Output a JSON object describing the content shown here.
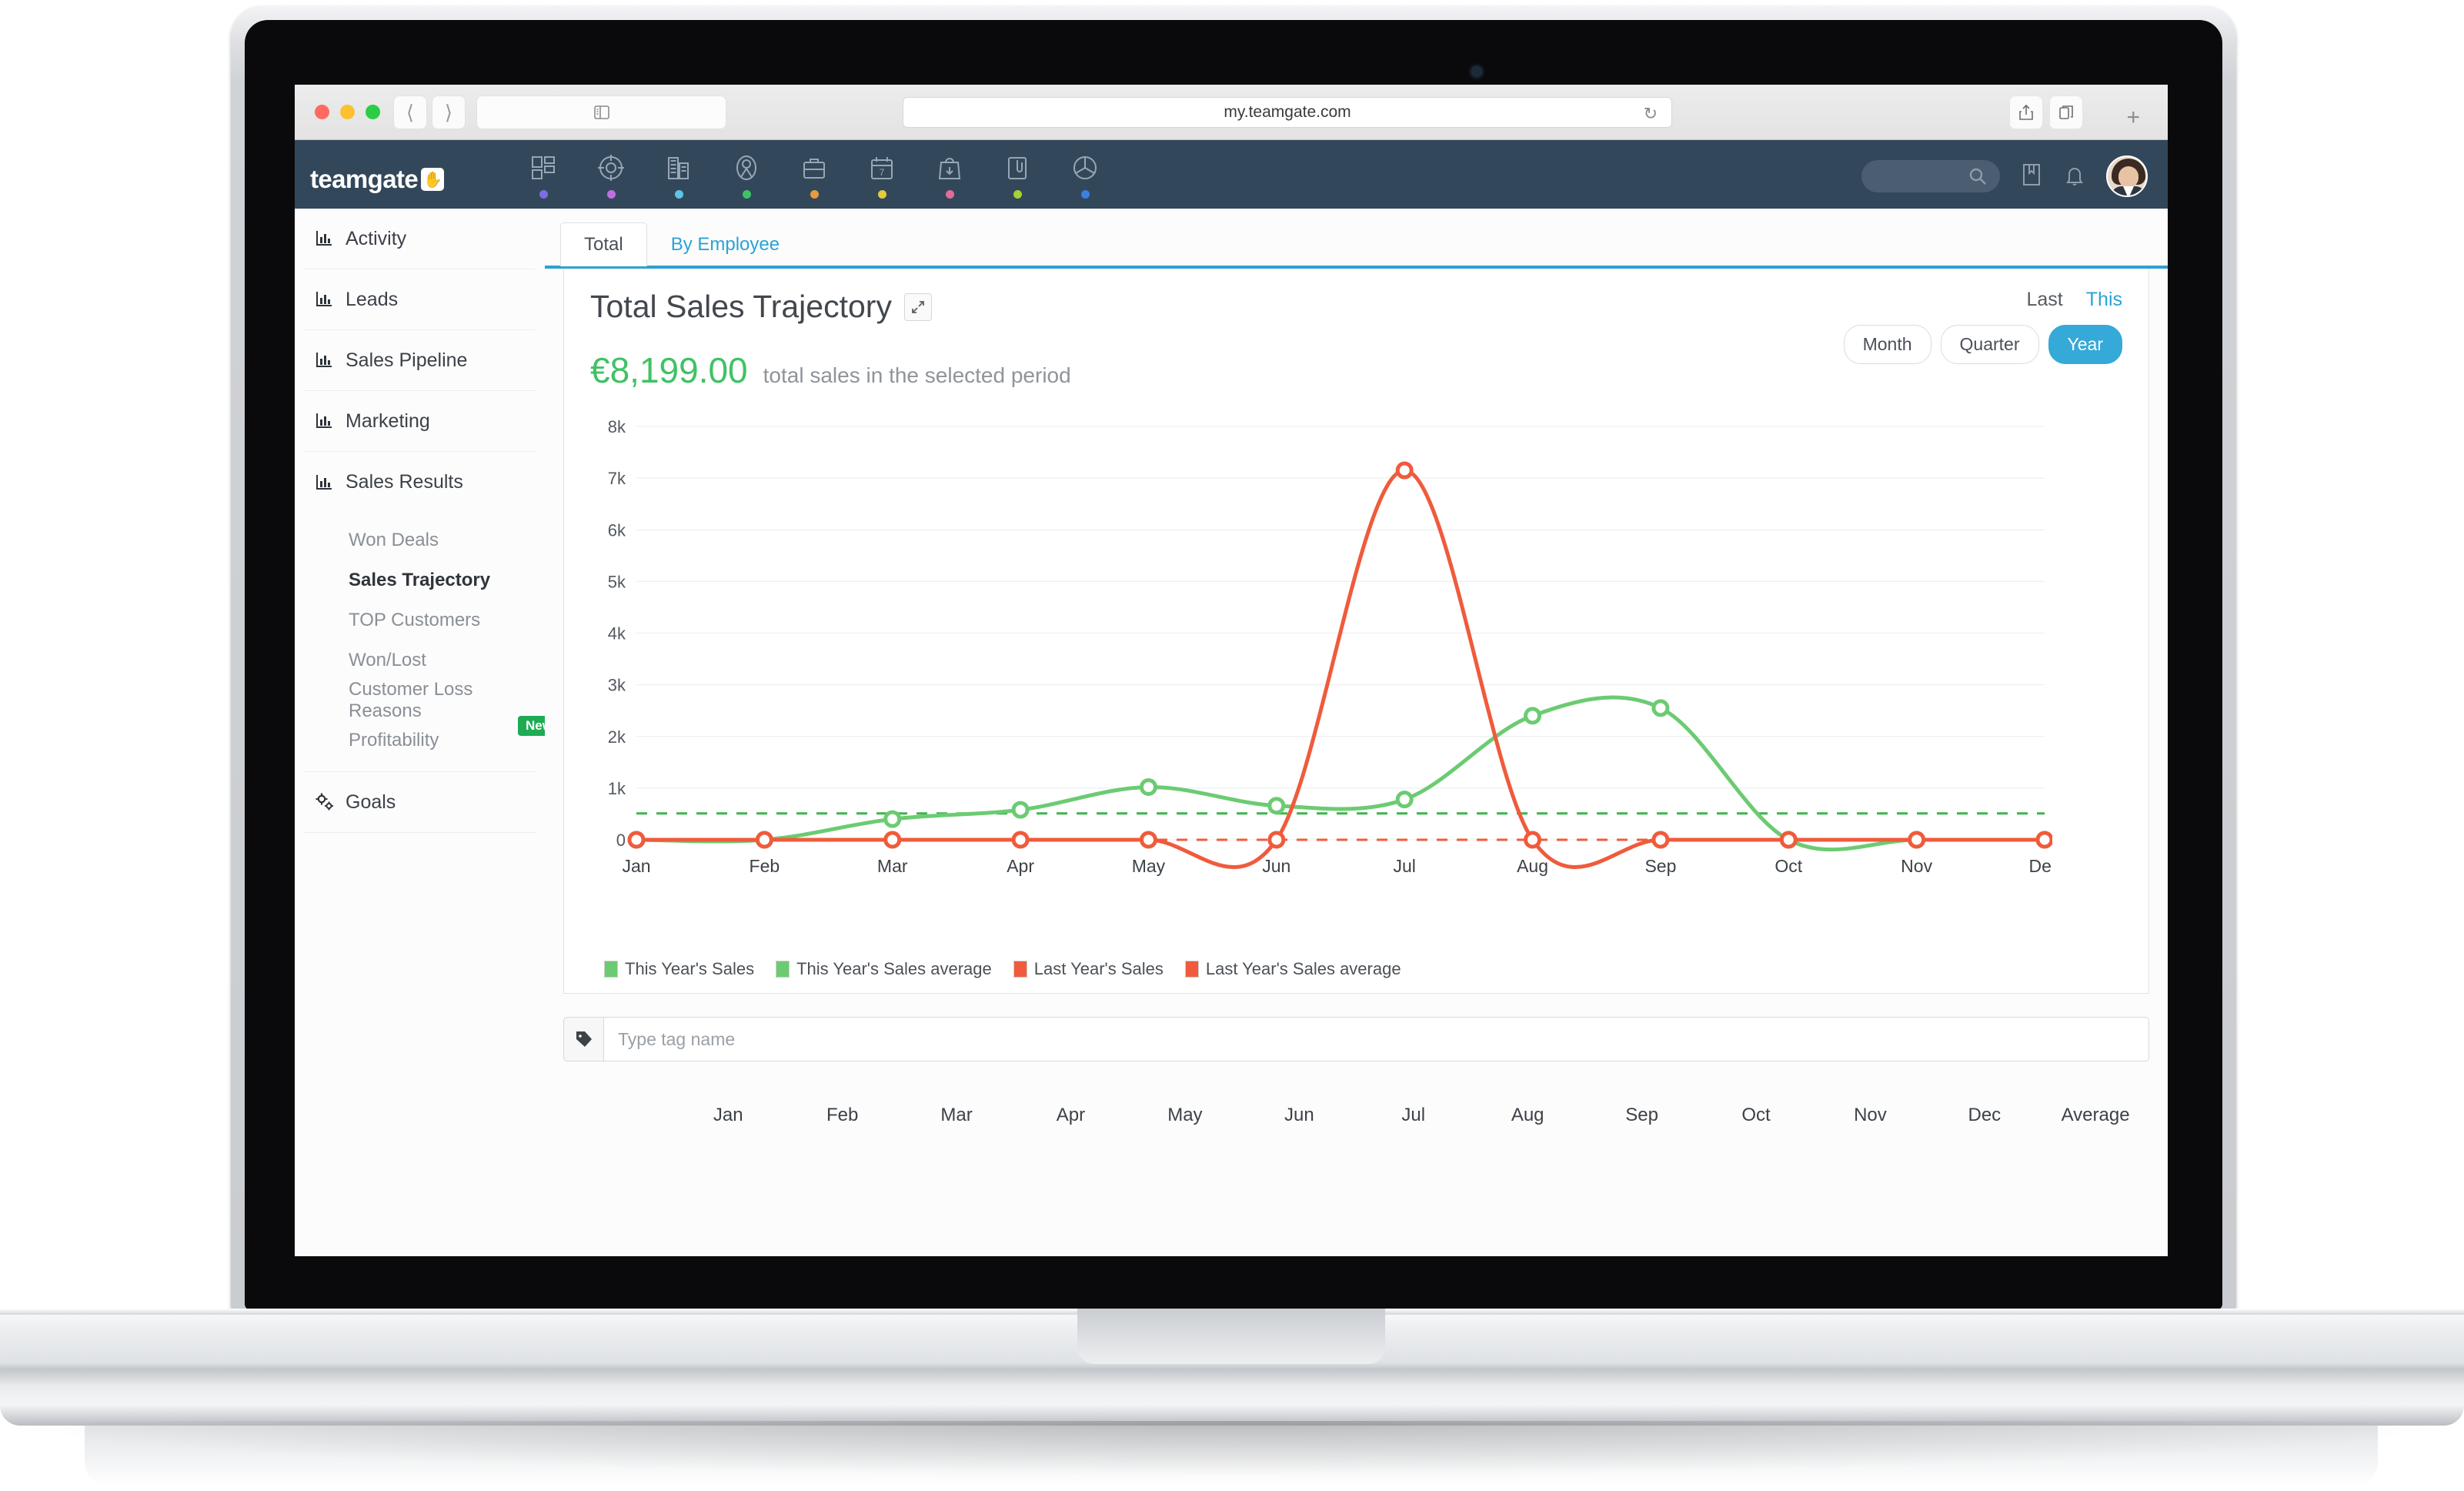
{
  "browser": {
    "url": "my.teamgate.com",
    "reload_icon": "reload-icon",
    "back_icon": "chevron-left-icon",
    "forward_icon": "chevron-right-icon",
    "sidebar_icon": "sidebar-toggle-icon",
    "share_icon": "share-icon",
    "tabs_icon": "tab-overview-icon",
    "newtab_label": "+"
  },
  "topbar": {
    "logo_text": "teamgate",
    "logo_badge": "✋",
    "nav_icons": [
      {
        "name": "dashboard-icon",
        "dot": "#7b6ee0"
      },
      {
        "name": "target-icon",
        "dot": "#c06fe0"
      },
      {
        "name": "company-icon",
        "dot": "#5fc3e8"
      },
      {
        "name": "person-icon",
        "dot": "#3fc264"
      },
      {
        "name": "briefcase-icon",
        "dot": "#e89b3c"
      },
      {
        "name": "calendar-icon",
        "dot": "#e8c83c"
      },
      {
        "name": "shopping-bag-icon",
        "dot": "#e06c9b"
      },
      {
        "name": "clipboard-icon",
        "dot": "#a8d035"
      },
      {
        "name": "pie-chart-icon",
        "dot": "#3c7fe0"
      }
    ],
    "calendar_day": "7",
    "search_icon": "search-icon",
    "search_value": "",
    "book_icon": "knowledge-base-icon",
    "bell_icon": "notifications-icon",
    "avatar_name": "user-avatar"
  },
  "sidebar": {
    "items": [
      {
        "label": "Activity",
        "icon": "bar-chart-icon"
      },
      {
        "label": "Leads",
        "icon": "bar-chart-icon"
      },
      {
        "label": "Sales Pipeline",
        "icon": "bar-chart-icon"
      },
      {
        "label": "Marketing",
        "icon": "bar-chart-icon"
      },
      {
        "label": "Sales Results",
        "icon": "bar-chart-icon"
      }
    ],
    "sub_items": [
      {
        "label": "Won Deals",
        "active": false,
        "badge": ""
      },
      {
        "label": "Sales Trajectory",
        "active": true,
        "badge": ""
      },
      {
        "label": "TOP Customers",
        "active": false,
        "badge": ""
      },
      {
        "label": "Won/Lost",
        "active": false,
        "badge": ""
      },
      {
        "label": "Customer Loss Reasons",
        "active": false,
        "badge": ""
      },
      {
        "label": "Profitability",
        "active": false,
        "badge": "New"
      }
    ],
    "goals": {
      "label": "Goals",
      "icon": "gears-icon"
    }
  },
  "main": {
    "tabs": [
      {
        "label": "Total",
        "active": true
      },
      {
        "label": "By Employee",
        "active": false
      }
    ],
    "page_title": "Total Sales Trajectory",
    "expand_icon": "expand-arrows-icon",
    "total_amount": "€8,199.00",
    "total_label": "total sales in the selected period",
    "period": {
      "last_label": "Last",
      "this_label": "This",
      "buttons": [
        {
          "label": "Month",
          "active": false
        },
        {
          "label": "Quarter",
          "active": false
        },
        {
          "label": "Year",
          "active": true
        }
      ]
    },
    "tag_input": {
      "icon": "tag-icon",
      "placeholder": "Type tag name",
      "value": ""
    },
    "bottom_table": {
      "columns": [
        "Jan",
        "Feb",
        "Mar",
        "Apr",
        "May",
        "Jun",
        "Jul",
        "Aug",
        "Sep",
        "Oct",
        "Nov",
        "Dec",
        "Average"
      ]
    }
  },
  "chart_data": {
    "type": "line",
    "title": "Total Sales Trajectory",
    "xlabel": "",
    "ylabel": "",
    "ylim": [
      0,
      8000
    ],
    "grid": true,
    "legend_position": "bottom-left",
    "categories": [
      "Jan",
      "Feb",
      "Mar",
      "Apr",
      "May",
      "Jun",
      "Jul",
      "Aug",
      "Sep",
      "Oct",
      "Nov",
      "Dec"
    ],
    "y_ticks": [
      "0",
      "1k",
      "2k",
      "3k",
      "4k",
      "5k",
      "6k",
      "7k",
      "8k"
    ],
    "y_tick_values": [
      0,
      1000,
      2000,
      3000,
      4000,
      5000,
      6000,
      7000,
      8000
    ],
    "series": [
      {
        "name": "This Year's Sales",
        "color": "#6ccb72",
        "style": "solid",
        "values": [
          0,
          0,
          400,
          580,
          1020,
          660,
          780,
          2400,
          2550,
          0,
          0,
          0
        ]
      },
      {
        "name": "This Year's Sales average",
        "color": "#3fb34f",
        "style": "dashed",
        "value": 510
      },
      {
        "name": "Last Year's Sales",
        "color": "#ef5b3c",
        "style": "solid",
        "values": [
          0,
          0,
          0,
          0,
          0,
          0,
          7150,
          0,
          0,
          0,
          0,
          0
        ]
      },
      {
        "name": "Last Year's Sales average",
        "color": "#ef5b3c",
        "style": "dashed",
        "value": 0
      }
    ]
  }
}
